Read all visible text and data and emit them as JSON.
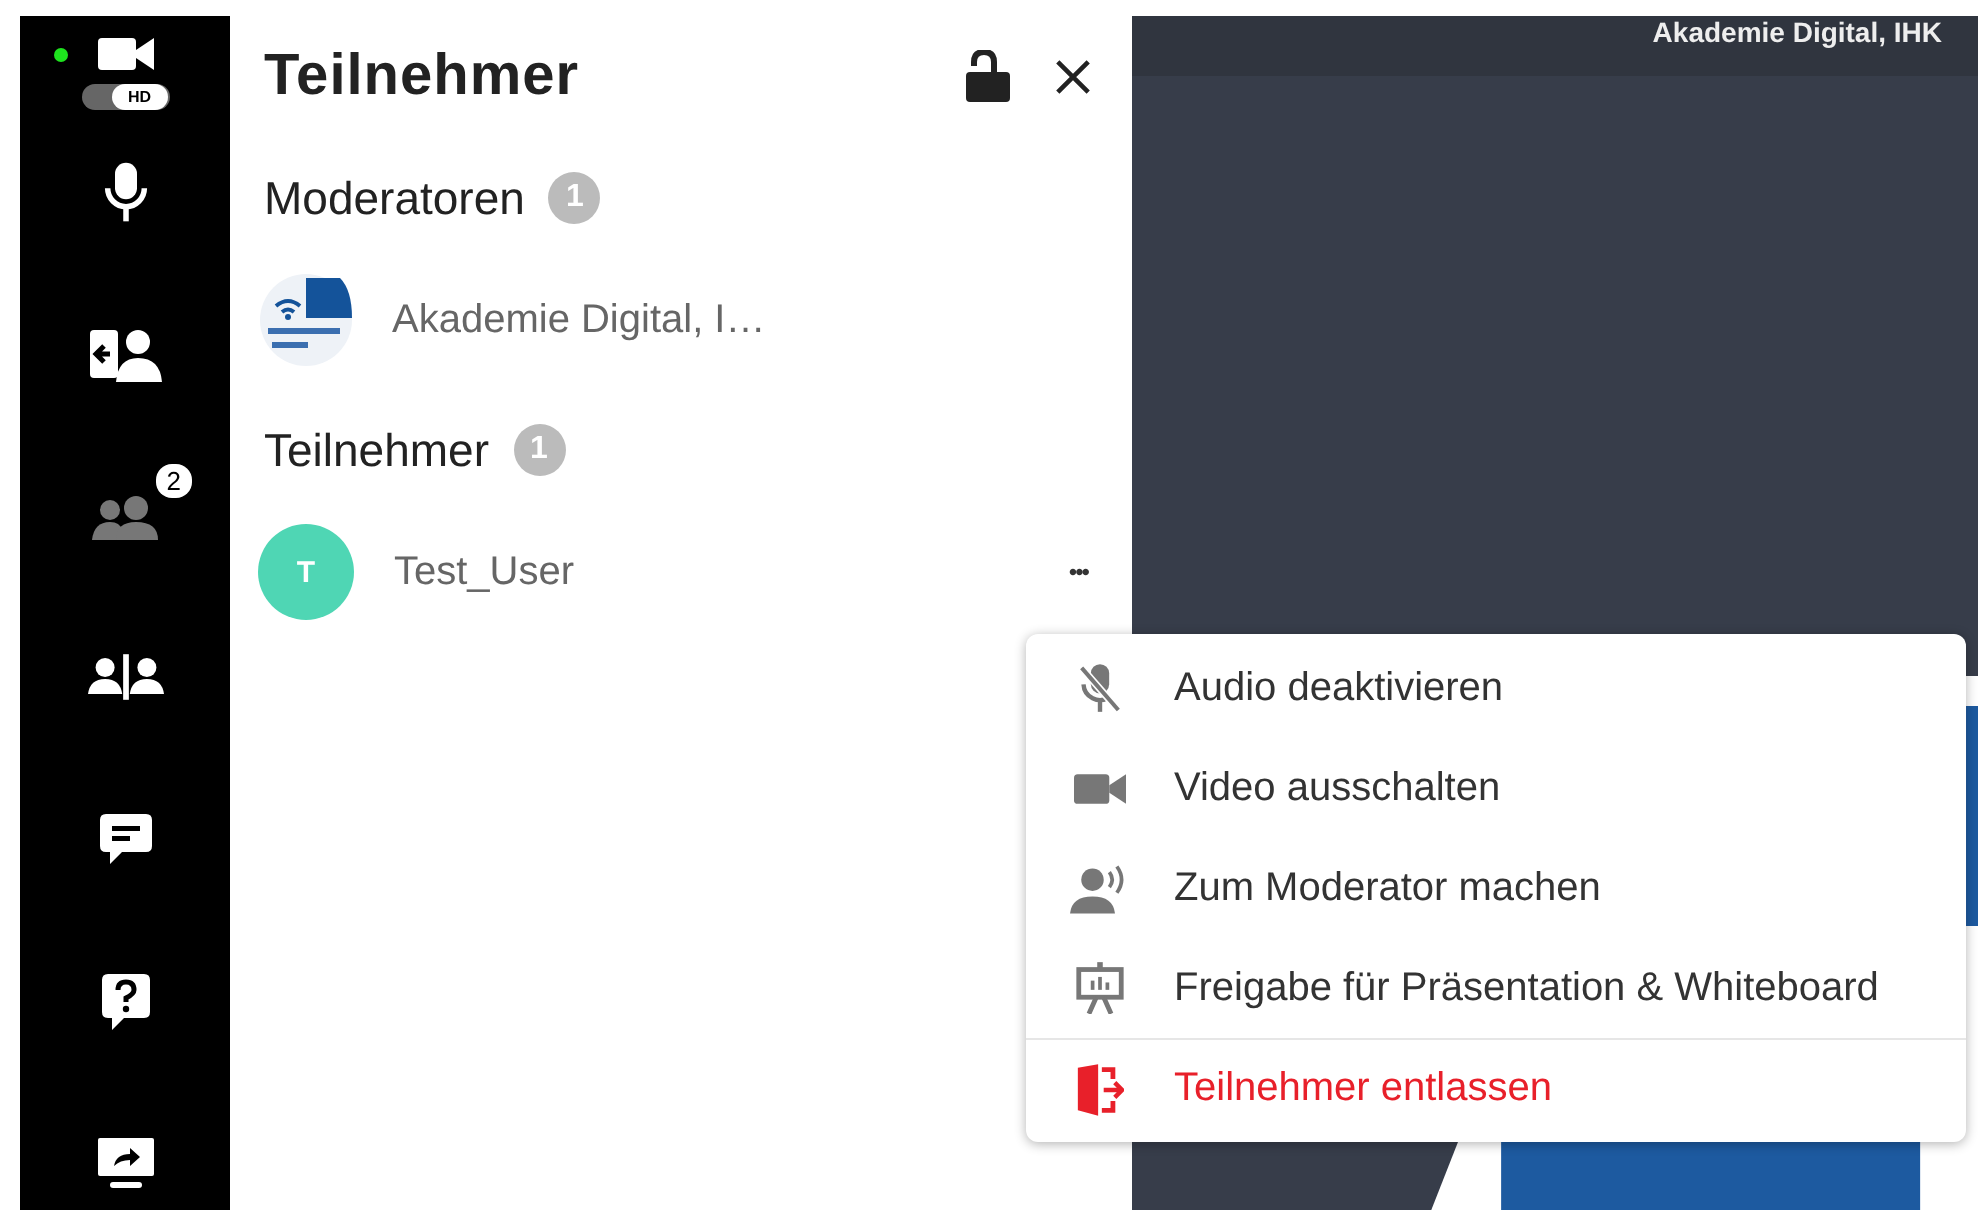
{
  "sidebar": {
    "camera": {
      "live": true
    },
    "hd": {
      "label": "HD",
      "on": true
    },
    "items": [
      {
        "kind": "mic",
        "selected": false
      },
      {
        "kind": "share-user",
        "selected": false
      },
      {
        "kind": "participants",
        "selected": true,
        "badge": "2"
      },
      {
        "kind": "split",
        "selected": false
      },
      {
        "kind": "chat",
        "selected": false
      },
      {
        "kind": "question",
        "selected": false
      },
      {
        "kind": "screen",
        "selected": false
      }
    ]
  },
  "panel": {
    "title": "Teilnehmer",
    "sections": [
      {
        "title": "Moderatoren",
        "count": "1",
        "members": [
          {
            "name": "Akademie Digital, I…",
            "avatar": {
              "kind": "logo"
            }
          }
        ]
      },
      {
        "title": "Teilnehmer",
        "count": "1",
        "members": [
          {
            "name": "Test_User",
            "avatar": {
              "kind": "initial",
              "initial": "T",
              "color": "#4fd6b4"
            },
            "more": "•••"
          }
        ]
      }
    ]
  },
  "video": {
    "name_label": "Akademie Digital, IHK"
  },
  "menu": [
    {
      "kind": "mic-off",
      "label": "Audio deaktivieren",
      "danger": false
    },
    {
      "kind": "video",
      "label": "Video ausschalten",
      "danger": false
    },
    {
      "kind": "moderator",
      "label": "Zum Moderator machen",
      "danger": false
    },
    {
      "kind": "presentation",
      "label": "Freigabe für Präsentation & Whiteboard",
      "danger": false
    },
    {
      "kind": "remove",
      "label": "Teilnehmer entlassen",
      "danger": true
    }
  ]
}
